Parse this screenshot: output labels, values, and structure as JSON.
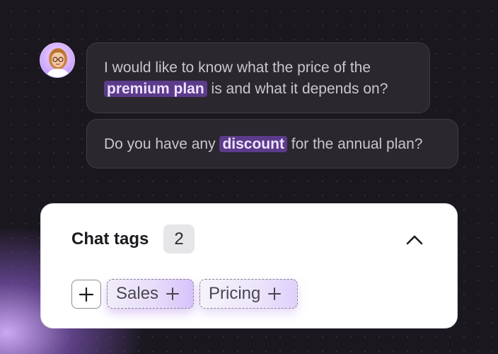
{
  "messages": [
    {
      "line1": "I would like to know what the price of the",
      "highlight": "premium plan",
      "after": "is and what it depends on?"
    },
    {
      "before": "Do you have any",
      "highlight": "discount",
      "after": "for the annual plan?"
    }
  ],
  "chat_tags": {
    "title": "Chat tags",
    "count": "2",
    "tags": [
      {
        "label": "Sales"
      },
      {
        "label": "Pricing"
      }
    ]
  },
  "icons": {
    "avatar": "user-avatar",
    "collapse": "chevron-up-icon",
    "add": "plus-icon"
  },
  "colors": {
    "highlight_bg": "#5b3b8a",
    "highlight_text": "#efe2ff",
    "tag_accent": "#d7c2fb"
  }
}
